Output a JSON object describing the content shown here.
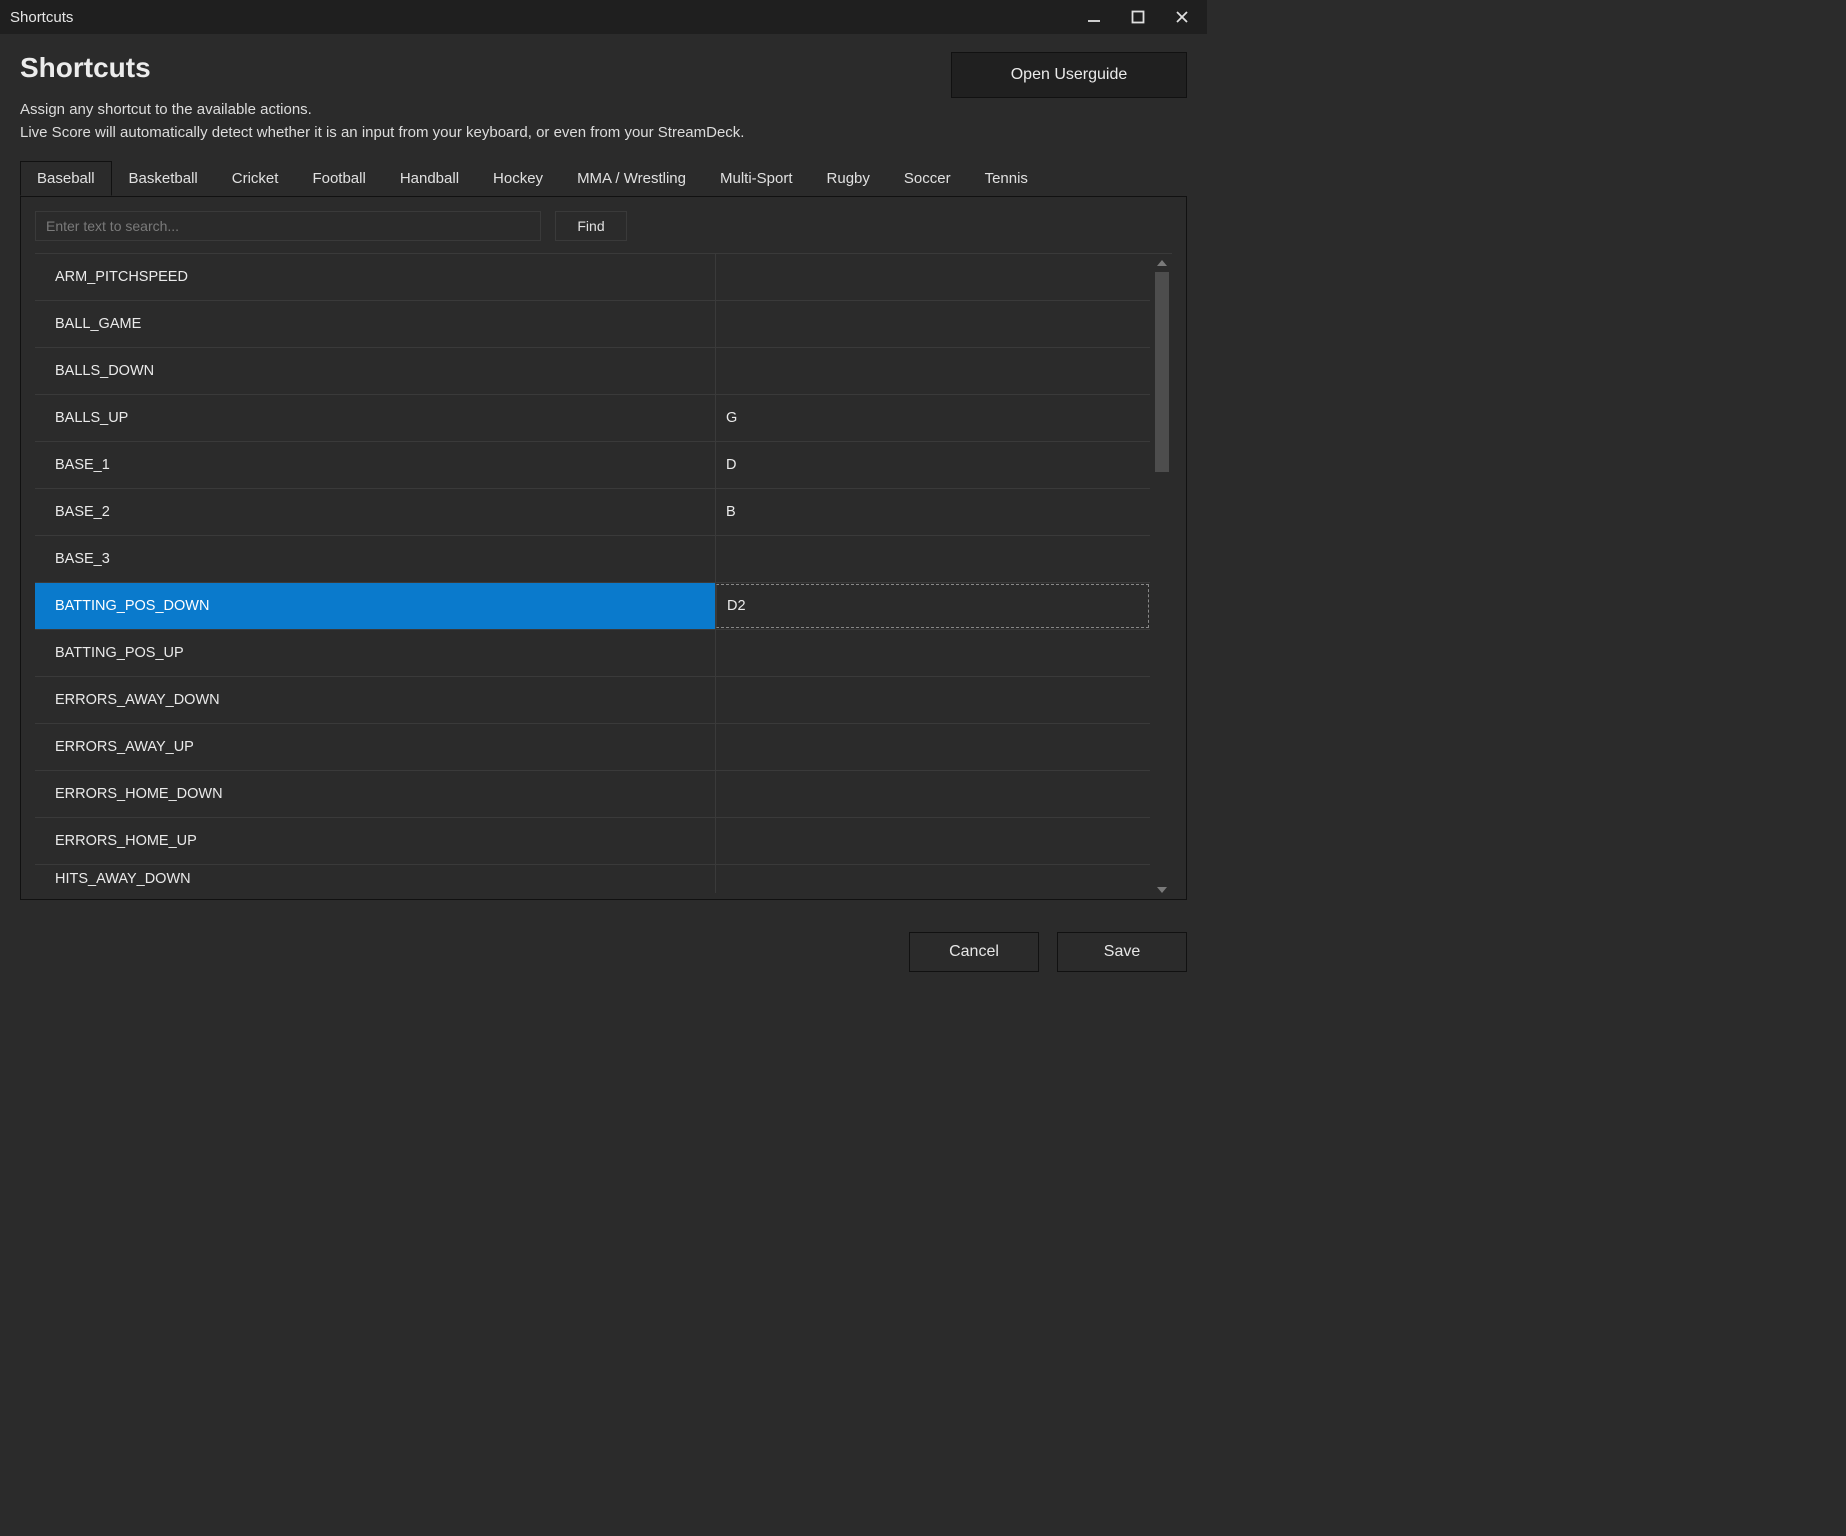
{
  "window": {
    "title": "Shortcuts"
  },
  "header": {
    "page_title": "Shortcuts",
    "open_userguide_label": "Open Userguide",
    "description_line1": "Assign any shortcut to the available actions.",
    "description_line2": "Live Score will automatically detect whether it is an input from your keyboard, or even from your StreamDeck."
  },
  "tabs": [
    {
      "label": "Baseball",
      "active": true
    },
    {
      "label": "Basketball",
      "active": false
    },
    {
      "label": "Cricket",
      "active": false
    },
    {
      "label": "Football",
      "active": false
    },
    {
      "label": "Handball",
      "active": false
    },
    {
      "label": "Hockey",
      "active": false
    },
    {
      "label": "MMA / Wrestling",
      "active": false
    },
    {
      "label": "Multi-Sport",
      "active": false
    },
    {
      "label": "Rugby",
      "active": false
    },
    {
      "label": "Soccer",
      "active": false
    },
    {
      "label": "Tennis",
      "active": false
    }
  ],
  "search": {
    "placeholder": "Enter text to search...",
    "value": "",
    "find_label": "Find"
  },
  "rows": [
    {
      "name": "ARM_PITCHSPEED",
      "key": "",
      "selected": false
    },
    {
      "name": "BALL_GAME",
      "key": "",
      "selected": false
    },
    {
      "name": "BALLS_DOWN",
      "key": "",
      "selected": false
    },
    {
      "name": "BALLS_UP",
      "key": "G",
      "selected": false
    },
    {
      "name": "BASE_1",
      "key": "D",
      "selected": false
    },
    {
      "name": "BASE_2",
      "key": "B",
      "selected": false
    },
    {
      "name": "BASE_3",
      "key": "",
      "selected": false
    },
    {
      "name": "BATTING_POS_DOWN",
      "key": "D2",
      "selected": true
    },
    {
      "name": "BATTING_POS_UP",
      "key": "",
      "selected": false
    },
    {
      "name": "ERRORS_AWAY_DOWN",
      "key": "",
      "selected": false
    },
    {
      "name": "ERRORS_AWAY_UP",
      "key": "",
      "selected": false
    },
    {
      "name": "ERRORS_HOME_DOWN",
      "key": "",
      "selected": false
    },
    {
      "name": "ERRORS_HOME_UP",
      "key": "",
      "selected": false
    },
    {
      "name": "HITS_AWAY_DOWN",
      "key": "",
      "selected": false,
      "partial": true
    }
  ],
  "footer": {
    "cancel_label": "Cancel",
    "save_label": "Save"
  }
}
